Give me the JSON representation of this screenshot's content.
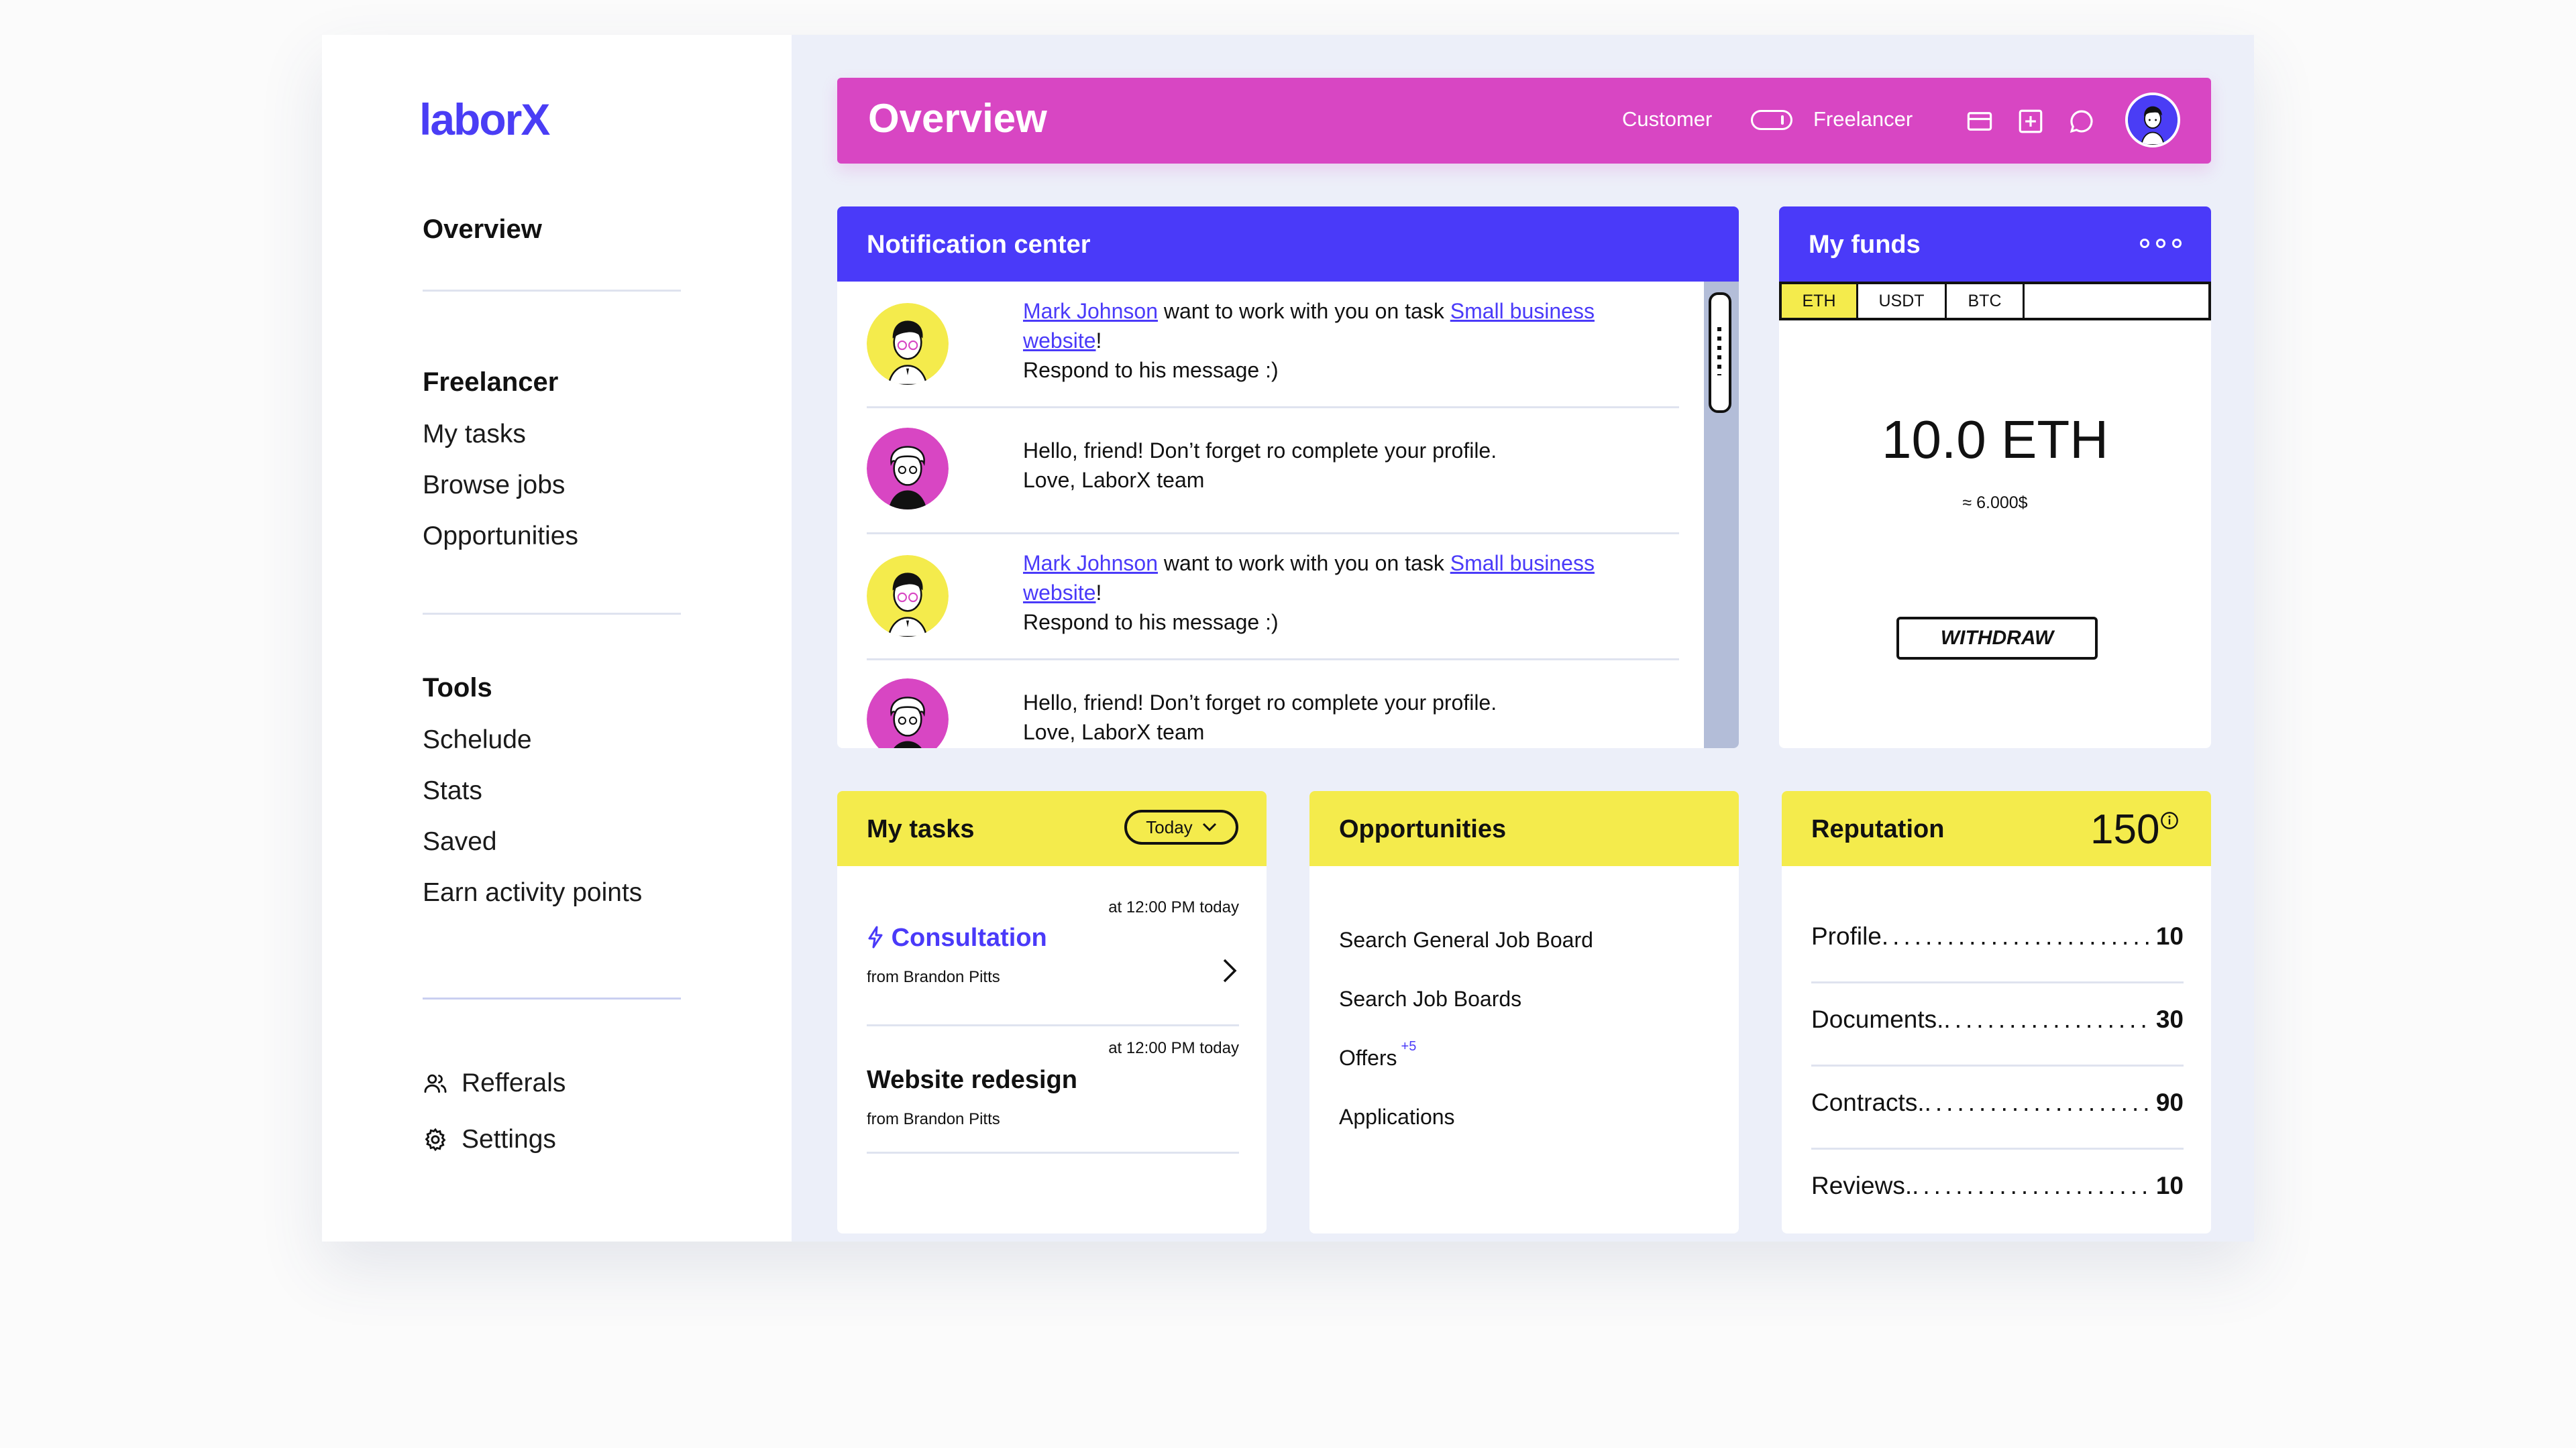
{
  "app": {
    "logo": "laborX"
  },
  "sidebar": {
    "overview": "Overview",
    "freelancer_section": "Freelancer",
    "freelancer_items": [
      "My tasks",
      "Browse jobs",
      "Opportunities"
    ],
    "tools_section": "Tools",
    "tools_items": [
      "Schelude",
      "Stats",
      "Saved",
      "Earn activity points"
    ],
    "referrals": "Refferals",
    "settings": "Settings"
  },
  "header": {
    "title": "Overview",
    "mode_left": "Customer",
    "mode_right": "Freelancer",
    "icons": [
      "card-icon",
      "add-icon",
      "chat-icon"
    ]
  },
  "notifications": {
    "title": "Notification center",
    "items": [
      {
        "type": "request",
        "user": "Mark Johnson",
        "text_mid": " want to work with you on task ",
        "task": "Small business website",
        "text_end": "!",
        "line2": "Respond to his message :)"
      },
      {
        "type": "system",
        "line1": "Hello, friend! Don’t forget ro complete your profile.",
        "line2": "Love, LaborX team"
      },
      {
        "type": "request",
        "user": "Mark Johnson",
        "text_mid": " want to work with you on task ",
        "task": "Small business website",
        "text_end": "!",
        "line2": "Respond to his message :)"
      },
      {
        "type": "system",
        "line1": "Hello, friend! Don’t forget ro complete your profile.",
        "line2": "Love, LaborX team"
      }
    ]
  },
  "funds": {
    "title": "My funds",
    "tabs": [
      "ETH",
      "USDT",
      "BTC"
    ],
    "active_tab": "ETH",
    "amount": "10.0 ETH",
    "usd": "≈ 6.000$",
    "withdraw": "WITHDRAW"
  },
  "tasks": {
    "title": "My tasks",
    "filter": "Today",
    "items": [
      {
        "when": "at 12:00 PM today",
        "name": "Consultation",
        "from": "from Brandon Pitts",
        "highlight": true
      },
      {
        "when": "at 12:00 PM today",
        "name": "Website redesign",
        "from": "from Brandon Pitts",
        "highlight": false
      }
    ]
  },
  "opportunities": {
    "title": "Opportunities",
    "items": [
      {
        "label": "Search General Job Board"
      },
      {
        "label": "Search Job Boards"
      },
      {
        "label": "Offers",
        "badge": "+5"
      },
      {
        "label": "Applications"
      }
    ]
  },
  "reputation": {
    "title": "Reputation",
    "score": "150",
    "rows": [
      {
        "label": "Profile",
        "value": "10"
      },
      {
        "label": "Documents.",
        "value": "30"
      },
      {
        "label": "Contracts.",
        "value": "90"
      },
      {
        "label": "Reviews.",
        "value": "10"
      }
    ]
  },
  "colors": {
    "accent_blue": "#4a3af9",
    "header_pink": "#d846c3",
    "yellow": "#f4eb4c",
    "background": "#eceff9"
  }
}
